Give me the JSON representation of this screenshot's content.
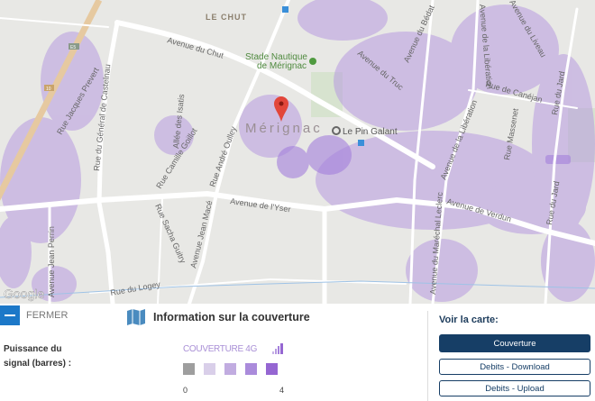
{
  "map": {
    "labels": {
      "le_chut": "LE CHUT",
      "avenue_du_chut": "Avenue du Chut",
      "stade_1": "Stade Nautique",
      "stade_2": "de Mérignac",
      "merignac": "Mérignac",
      "le_pin_galant": "Le Pin Galant",
      "avenue_yser": "Avenue de l'Yser",
      "avenue_truc": "Avenue du Truc",
      "avenue_bedat": "Avenue du Bédat",
      "avenue_liberation_1": "Avenue de la Libération",
      "avenue_liberation_2": "Avenue de la Libération",
      "avenue_liveau": "Avenue du Liveau",
      "rue_canejan": "Rue de Canéjan",
      "rue_massenet": "Rue Massenet",
      "rue_jard_1": "Rue du Jard",
      "rue_jard_2": "Rue du Jard",
      "avenue_verdun": "Avenue de Verdun",
      "avenue_leclerc": "Avenue du Maréchal Leclerc",
      "rue_prevert": "Rue Jacques Prevert",
      "rue_castelnau": "Rue du Général de Castelnau",
      "allee_isatis": "Allée des Isatis",
      "rue_goillot": "Rue Camille Goillot",
      "rue_oulley": "Rue André Oulley",
      "rue_guitry": "Rue Sacha Guitry",
      "avenue_mace": "Avenue Jean Macé",
      "avenue_perrin": "Avenue Jean Perrin",
      "rue_logey": "Rue du Logey",
      "shield_e5": "E5",
      "shield_10": "10"
    },
    "google_logo": "Google"
  },
  "panel": {
    "close_label": "FERMER",
    "title": "Information sur la couverture",
    "signal_label_1": "Puissance du",
    "signal_label_2": "signal (barres) :",
    "coverage_label": "COUVERTURE 4G",
    "legend_min": "0",
    "legend_max": "4",
    "legend_colors": [
      "#9e9e9e",
      "#d9cfe9",
      "#c1ace0",
      "#aa8bdb",
      "#9566d2"
    ],
    "see_map_label": "Voir la carte:",
    "buttons": [
      {
        "label": "Couverture",
        "active": true
      },
      {
        "label": "Debits - Download",
        "active": false
      },
      {
        "label": "Debits - Upload",
        "active": false
      }
    ]
  }
}
